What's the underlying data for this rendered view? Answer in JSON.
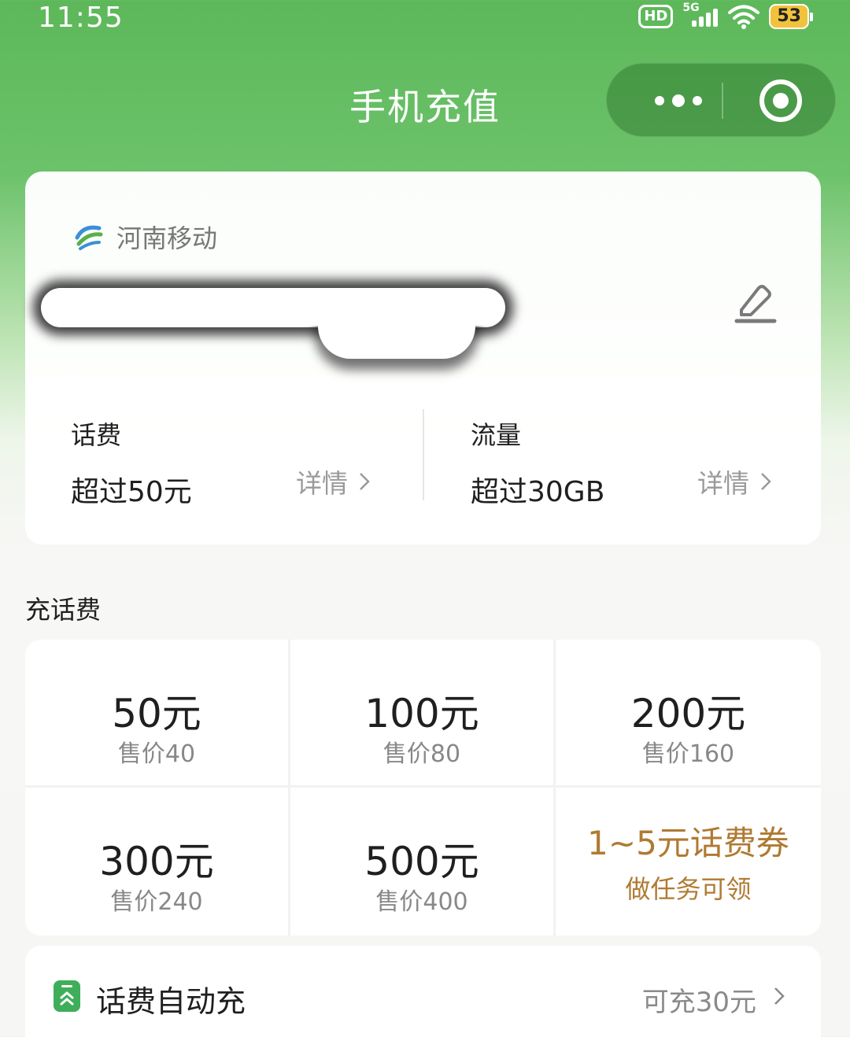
{
  "status_bar": {
    "time": "11:55",
    "hd": "HD",
    "network": "5G",
    "battery": "53"
  },
  "header": {
    "title": "手机充值",
    "more_icon": "more-dots-icon",
    "close_icon": "close-circle-icon"
  },
  "account": {
    "carrier": "河南移动",
    "phone_number": "",
    "phone_redacted": true,
    "balance": {
      "label": "话费",
      "value": "超过50元",
      "detail": "详情"
    },
    "data": {
      "label": "流量",
      "value": "超过30GB",
      "detail": "详情"
    }
  },
  "recharge": {
    "section_title": "充话费",
    "options": [
      {
        "amount": "50元",
        "price": "售价40"
      },
      {
        "amount": "100元",
        "price": "售价80"
      },
      {
        "amount": "200元",
        "price": "售价160"
      },
      {
        "amount": "300元",
        "price": "售价240"
      },
      {
        "amount": "500元",
        "price": "售价400"
      }
    ],
    "coupon": {
      "title": "1~5元话费券",
      "subtitle": "做任务可领"
    }
  },
  "auto_recharge": {
    "label": "话费自动充",
    "value": "可充30元"
  },
  "colors": {
    "brand_green": "#5db85a",
    "coupon_gold": "#b07a32",
    "auto_icon_green": "#3fae5a"
  }
}
